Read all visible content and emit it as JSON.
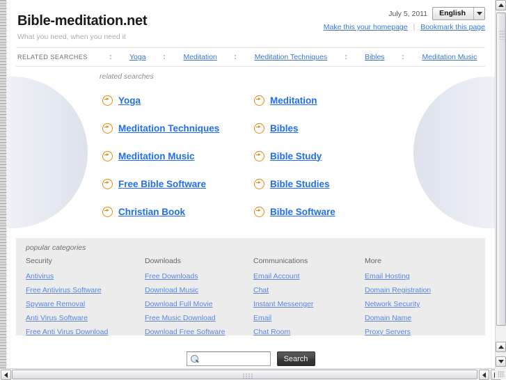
{
  "header": {
    "title": "Bible-meditation.net",
    "tagline": "What you need, when you need it",
    "date": "July 5, 2011",
    "language": "English",
    "homepage_link": "Make this your homepage",
    "separator": "|",
    "bookmark_link": "Bookmark this page"
  },
  "navbar": {
    "caption": "RELATED SEARCHES",
    "items": [
      {
        "label": "Yoga"
      },
      {
        "label": "Meditation"
      },
      {
        "label": "Meditation Techniques"
      },
      {
        "label": "Bibles"
      },
      {
        "label": "Meditation Music"
      }
    ]
  },
  "related_searches": {
    "caption": "related searches",
    "items": [
      {
        "label": "Yoga"
      },
      {
        "label": "Meditation"
      },
      {
        "label": "Meditation Techniques"
      },
      {
        "label": "Bibles"
      },
      {
        "label": "Meditation Music"
      },
      {
        "label": "Bible Study"
      },
      {
        "label": "Free Bible Software"
      },
      {
        "label": "Bible Studies"
      },
      {
        "label": "Christian Book"
      },
      {
        "label": "Bible Software"
      }
    ]
  },
  "popular_categories": {
    "caption": "popular categories",
    "columns": [
      {
        "heading": "Security",
        "links": [
          "Antivirus",
          "Free Antivirus Software",
          "Spyware Removal",
          "Anti Virus Software",
          "Free Anti Virus Download"
        ]
      },
      {
        "heading": "Downloads",
        "links": [
          "Free Downloads",
          "Download Music",
          "Download Full Movie",
          "Free Music Download",
          "Download Free Software"
        ]
      },
      {
        "heading": "Communications",
        "links": [
          "Email Account",
          "Chat",
          "Instant Messenger",
          "Email",
          "Chat Room"
        ]
      },
      {
        "heading": "More",
        "links": [
          "Email Hosting",
          "Domain Registration",
          "Network Security",
          "Domain Name",
          "Proxy Servers"
        ]
      }
    ]
  },
  "search": {
    "value": "",
    "placeholder": "",
    "button_label": "Search",
    "icon": "magnifier-icon"
  },
  "colors": {
    "link_blue": "#1f6ef0",
    "nav_link_blue": "#3a76d4",
    "category_link_blue": "#5a86e0",
    "arrow_orange": "#e8890c",
    "category_panel_bg": "#ececec",
    "tagline_gray": "#adadad"
  },
  "scrollbars": {
    "vertical": {
      "up": "scroll-up-arrow",
      "down": "scroll-down-arrow"
    },
    "horizontal": {
      "left": "scroll-left-arrow",
      "right": "scroll-right-arrow"
    }
  }
}
